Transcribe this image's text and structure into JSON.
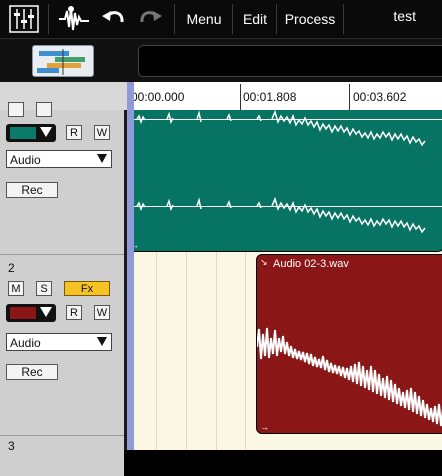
{
  "toolbar": {
    "menus": [
      "Menu",
      "Edit",
      "Process"
    ],
    "song_title": "test"
  },
  "ruler": {
    "marks": [
      "00:00.000",
      "00:01.808",
      "00:03.602"
    ]
  },
  "tracks": [
    {
      "number": "",
      "color": "#0b7a69",
      "dropdown": "Audio",
      "rec_label": "Rec",
      "r_label": "R",
      "w_label": "W"
    },
    {
      "number": "2",
      "color": "#8b1616",
      "dropdown": "Audio",
      "rec_label": "Rec",
      "r_label": "R",
      "w_label": "W",
      "m_label": "M",
      "s_label": "S",
      "fx_label": "Fx"
    },
    {
      "number": "3"
    }
  ],
  "clips": [
    {
      "name": "",
      "color": "#077363"
    },
    {
      "name": "Audio 02-3.wav",
      "color": "#8b1616"
    }
  ],
  "colors": {
    "track1": "#0b7a69",
    "track2": "#8b1616",
    "fx": "#f6c324",
    "playhead": "#8e9bd8"
  }
}
